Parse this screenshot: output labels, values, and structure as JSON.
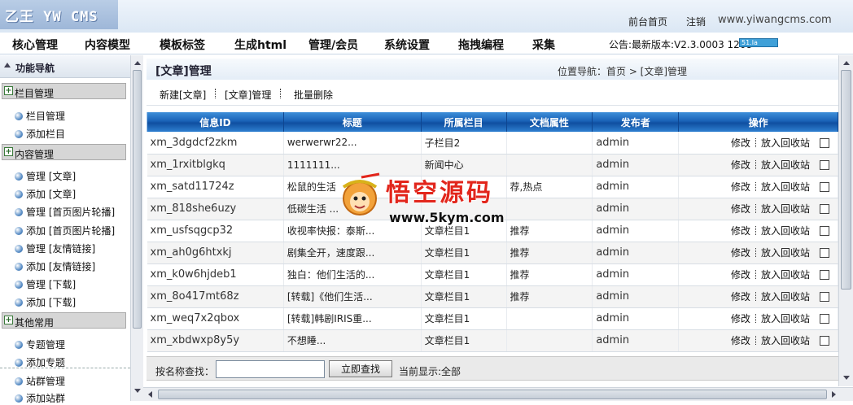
{
  "header": {
    "logo_text": "乙王 YW CMS",
    "links": {
      "front": "前台首页",
      "logout": "注销"
    },
    "site_url": "www.yiwangcms.com"
  },
  "nav": {
    "items": [
      "核心管理",
      "内容模型",
      "模板标签",
      "生成html",
      "管理/会员",
      "系统设置",
      "拖拽编程",
      "采集"
    ],
    "notice": "公告:最新版本:V2.3.0003 1208",
    "counter_text": "51.la"
  },
  "sidebar": {
    "title": "功能导航",
    "groups": [
      {
        "label": "栏目管理",
        "items": [
          "栏目管理",
          "添加栏目"
        ]
      },
      {
        "label": "内容管理",
        "items": [
          "管理 [文章]",
          "添加 [文章]",
          "管理 [首页图片轮播]",
          "添加 [首页图片轮播]",
          "管理 [友情链接]",
          "添加 [友情链接]",
          "管理 [下载]",
          "添加 [下载]"
        ]
      },
      {
        "label": "其他常用",
        "items": [
          "专题管理",
          "添加专题",
          "站群管理",
          "添加站群"
        ]
      }
    ]
  },
  "content": {
    "title": "[文章]管理",
    "location": "位置导航：首页 > [文章]管理",
    "toolbar": {
      "new": "新建[文章]",
      "manage": "[文章]管理",
      "batch_delete": "批量删除"
    },
    "table": {
      "headers": [
        "信息ID",
        "标题",
        "所属栏目",
        "文档属性",
        "发布者",
        "操作"
      ],
      "rows": [
        {
          "id": "xm_3dgdcf2zkm",
          "title": "werwerwr22...",
          "column": "子栏目2",
          "attr": "",
          "author": "admin"
        },
        {
          "id": "xm_1rxitblgkq",
          "title": "1111111...",
          "column": "新闻中心",
          "attr": "",
          "author": "admin"
        },
        {
          "id": "xm_satd11724z",
          "title": "松鼠的生活",
          "column": "",
          "attr": "荐,热点",
          "author": "admin"
        },
        {
          "id": "xm_818she6uzy",
          "title": "低碳生活 ...",
          "column": "",
          "attr": "",
          "author": "admin"
        },
        {
          "id": "xm_usfsqgcp32",
          "title": "收视率快报：泰斯...",
          "column": "文章栏目1",
          "attr": "推荐",
          "author": "admin"
        },
        {
          "id": "xm_ah0g6htxkj",
          "title": "剧集全开，速度跟...",
          "column": "文章栏目1",
          "attr": "推荐",
          "author": "admin"
        },
        {
          "id": "xm_k0w6hjdeb1",
          "title": "独白：他们生活的...",
          "column": "文章栏目1",
          "attr": "推荐",
          "author": "admin"
        },
        {
          "id": "xm_8o417mt68z",
          "title": "[转载]《他们生活...",
          "column": "文章栏目1",
          "attr": "推荐",
          "author": "admin"
        },
        {
          "id": "xm_weq7x2qbox",
          "title": "[转载]韩剧IRIS重...",
          "column": "文章栏目1",
          "attr": "",
          "author": "admin"
        },
        {
          "id": "xm_xbdwxp8y5y",
          "title": "不想睡...",
          "column": "文章栏目1",
          "attr": "",
          "author": "admin"
        }
      ],
      "op_edit": "修改",
      "op_recycle": "放入回收站"
    },
    "search": {
      "label": "按名称查找：",
      "value": "",
      "button": "立即查找",
      "current": "当前显示:全部"
    }
  },
  "watermark": {
    "text_cn": "悟空源码",
    "url": "www.5kym.com"
  },
  "colors": {
    "table_header": "#1a62b7",
    "logo_bg": "#9eb7d8",
    "watermark_red": "#e2261c"
  }
}
